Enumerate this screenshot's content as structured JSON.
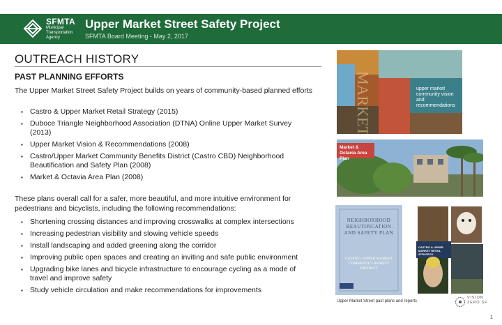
{
  "header": {
    "logo_word": "SFMTA",
    "logo_sub": "Municipal Transportation Agency",
    "title": "Upper Market Street Safety Project",
    "subtitle": "SFMTA Board Meeting - May 2, 2017"
  },
  "section": {
    "heading": "OUTREACH HISTORY",
    "subheading": "PAST PLANNING EFFORTS"
  },
  "intro": "The Upper Market Street Safety Project builds on years of community-based planned efforts",
  "efforts": [
    "Castro & Upper Market Retail Strategy (2015)",
    "Duboce Triangle Neighborhood Association (DTNA) Online Upper Market Survey (2013)",
    "Upper Market Vision & Recommendations (2008)",
    "Castro/Upper Market Community Benefits District (Castro CBD) Neighborhood Beautification and Safety Plan (2008)",
    "Market & Octavia Area Plan (2008)"
  ],
  "summary": "These plans overall call for a safer, more beautiful, and more intuitive environment for pedestrians and bicyclists, including the following recommendations:",
  "recommendations": [
    "Shortening crossing distances and improving crosswalks at complex intersections",
    "Increasing pedestrian visibility and slowing vehicle speeds",
    "Install landscaping and added greening along the corridor",
    "Improving public open spaces and creating an inviting and safe public environment",
    "Upgrading bike lanes and bicycle infrastructure to encourage cycling as a mode of travel and improve safety",
    "Study vehicle circulation and make recommendations for improvements"
  ],
  "images": {
    "top_text": "upper market community vision and recommendations",
    "mid_text": "Market & Octavia Area Plan",
    "book_title": "Neighborhood Beautification and Safety Plan",
    "book_sub": "Castro / Upper Market Community Benefit District",
    "retail_text": "CASTRO & UPPER MARKET RETAIL STRATEGY",
    "caption": "Upper Market Street past plans and reports"
  },
  "vision_zero": "VISION ZERO SF",
  "page_number": "1",
  "colors": {
    "header_green": "#1f6b3a"
  }
}
